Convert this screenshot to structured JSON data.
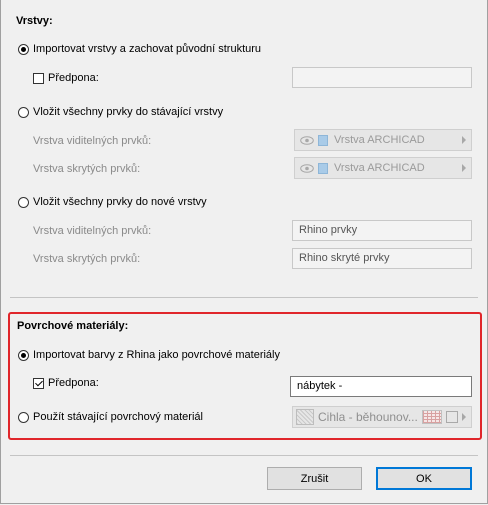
{
  "layers": {
    "title": "Vrstvy:",
    "option_import": "Importovat vrstvy a zachovat původní strukturu",
    "prefix_label": "Předpona:",
    "prefix_value": "",
    "option_existing": "Vložit všechny prvky do stávající vrstvy",
    "existing_visible_label": "Vrstva viditelných prvků:",
    "existing_visible_value": "Vrstva ARCHICAD",
    "existing_hidden_label": "Vrstva skrytých prvků:",
    "existing_hidden_value": "Vrstva ARCHICAD",
    "option_new": "Vložit všechny prvky do nové vrstvy",
    "new_visible_label": "Vrstva viditelných prvků:",
    "new_visible_value": "Rhino prvky",
    "new_hidden_label": "Vrstva skrytých prvků:",
    "new_hidden_value": "Rhino skryté prvky"
  },
  "materials": {
    "title": "Povrchové materiály:",
    "option_import": "Importovat barvy z Rhina jako povrchové materiály",
    "prefix_label": "Předpona:",
    "prefix_value": "nábytek -",
    "option_existing": "Použít stávající povrchový materiál",
    "existing_value": "Cihla - běhounov..."
  },
  "buttons": {
    "cancel": "Zrušit",
    "ok": "OK"
  },
  "colors": {
    "highlight": "#e0262b",
    "default_button_border": "#0078d7"
  },
  "icons": {
    "eye": "eye-icon",
    "layer": "layer-icon",
    "surface_pattern": "surface-pattern-icon",
    "brick_texture": "brick-texture-icon"
  }
}
